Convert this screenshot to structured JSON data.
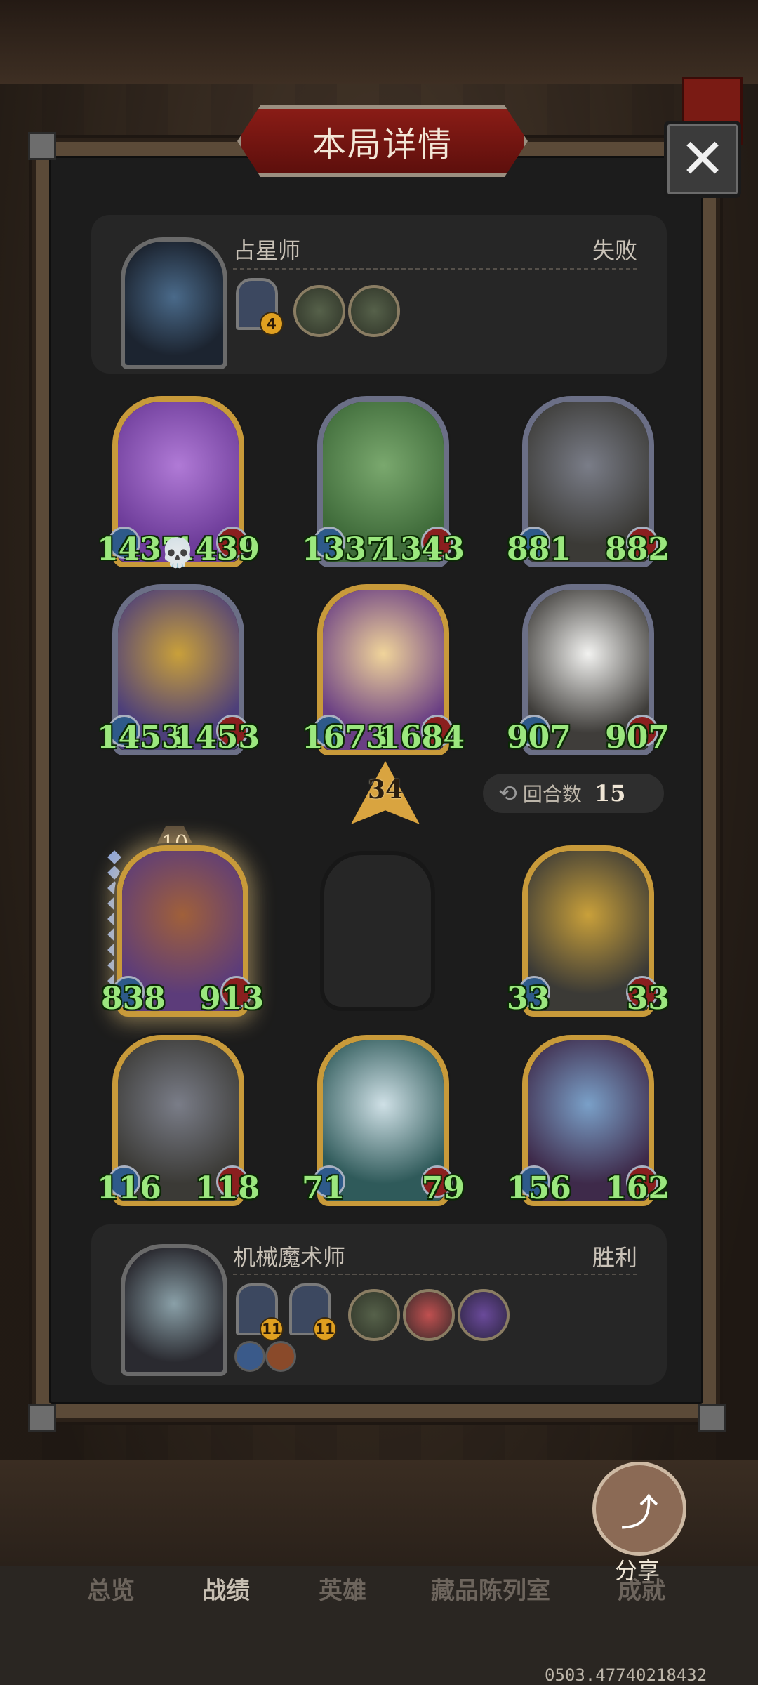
{
  "header": {
    "title": "本局详情",
    "close_glyph": "✕"
  },
  "opponent": {
    "name": "占星师",
    "result": "失败",
    "items": [
      {
        "badge": "4"
      }
    ],
    "icons": [
      "leaf-ring-icon",
      "pink-wand-icon"
    ]
  },
  "opponent_board": [
    {
      "atk": "1437",
      "hp": "1439",
      "frame": "gold",
      "art": "#6e3d9a"
    },
    {
      "atk": "1337",
      "hp": "1343",
      "frame": "silver",
      "art": "#3f6b3a"
    },
    {
      "atk": "881",
      "hp": "882",
      "frame": "silver",
      "art": "#3b3a36"
    },
    {
      "atk": "1453",
      "hp": "1453",
      "frame": "silver",
      "art": "#4d3f7a"
    },
    {
      "atk": "1673",
      "hp": "1684",
      "frame": "gold",
      "art": "#6a3f84"
    },
    {
      "atk": "907",
      "hp": "907",
      "frame": "silver",
      "art": "#3f3d3a"
    }
  ],
  "combat": {
    "damage": "34",
    "round_label": "回合数",
    "round_value": "15",
    "level": "10"
  },
  "player_board": [
    {
      "atk": "838",
      "hp": "913",
      "frame": "gold",
      "art": "#5c3c7a"
    },
    {
      "atk": "33",
      "hp": "33",
      "frame": "gold",
      "art": "#3b3a36"
    },
    {
      "atk": "116",
      "hp": "118",
      "frame": "gold",
      "art": "#3b3a36"
    },
    {
      "atk": "71",
      "hp": "79",
      "frame": "gold",
      "art": "#2f5a5a"
    },
    {
      "atk": "156",
      "hp": "162",
      "frame": "gold",
      "art": "#3e2a4a"
    }
  ],
  "player": {
    "name": "机械魔术师",
    "result": "胜利",
    "items": [
      {
        "badge": "11"
      },
      {
        "badge": "11"
      }
    ],
    "icons": [
      "flower-icon",
      "red-hat-icon",
      "purple-totem-icon"
    ]
  },
  "share": {
    "label": "分享"
  },
  "tabs": [
    "总览",
    "战绩",
    "英雄",
    "藏品陈列室",
    "成就"
  ],
  "uid": "0503.47740218432"
}
